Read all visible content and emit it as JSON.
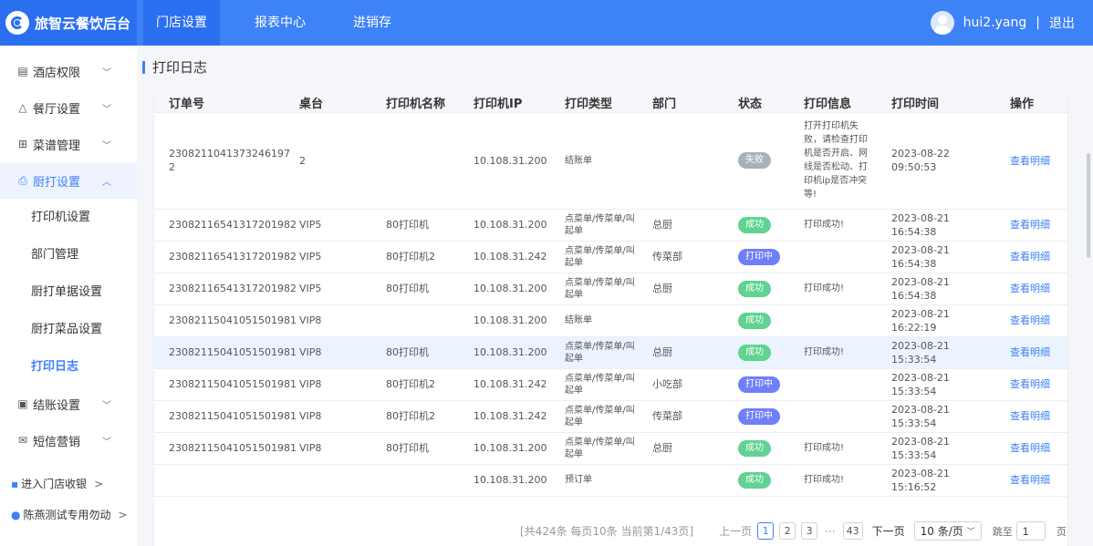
{
  "brand": {
    "name": "旅智云餐饮后台"
  },
  "topnav": [
    {
      "label": "门店设置"
    },
    {
      "label": "报表中心"
    },
    {
      "label": "进销存"
    }
  ],
  "user": {
    "name": "hui2.yang",
    "separator": "|",
    "logout": "退出"
  },
  "sidebar": {
    "groups": [
      {
        "label": "酒店权限",
        "icon": "hotel-icon"
      },
      {
        "label": "餐厅设置",
        "icon": "restaurant-icon"
      },
      {
        "label": "菜谱管理",
        "icon": "menu-grid-icon"
      },
      {
        "label": "厨打设置",
        "icon": "printer-icon"
      }
    ],
    "submenu": [
      {
        "label": "打印机设置"
      },
      {
        "label": "部门管理"
      },
      {
        "label": "厨打单据设置"
      },
      {
        "label": "厨打菜品设置"
      },
      {
        "label": "打印日志"
      }
    ],
    "groups2": [
      {
        "label": "结账设置",
        "icon": "checkout-icon"
      },
      {
        "label": "短信营销",
        "icon": "sms-icon"
      }
    ],
    "footer": {
      "shop_prefix": "进入门店收银",
      "shop_name": "陈燕测试专用勿动"
    }
  },
  "page": {
    "title": "打印日志"
  },
  "table": {
    "headers": [
      "订单号",
      "桌台",
      "打印机名称",
      "打印机IP",
      "打印类型",
      "部门",
      "状态",
      "打印信息",
      "打印时间",
      "操作"
    ],
    "rows": [
      {
        "order": "2308211041373246197​2",
        "table": "2",
        "printer": "",
        "ip": "10.108.31.200",
        "type": "结账单",
        "dept": "",
        "status": "失败",
        "status_kind": "fail",
        "info": "打开打印机失败，请检查打印机是否开启、网线是否松动、打印机ip是否冲突等!",
        "time": "2023-08-22 09:50:53",
        "action": "查看明细"
      },
      {
        "order": "23082116541317201982",
        "table": "VIP5",
        "printer": "80打印机",
        "ip": "10.108.31.200",
        "type": "点菜单/传菜单/叫起单",
        "dept": "总厨",
        "status": "成功",
        "status_kind": "ok",
        "info": "打印成功!",
        "time": "2023-08-21 16:54:38",
        "action": "查看明细"
      },
      {
        "order": "23082116541317201982",
        "table": "VIP5",
        "printer": "80打印机2",
        "ip": "10.108.31.242",
        "type": "点菜单/传菜单/叫起单",
        "dept": "传菜部",
        "status": "打印中",
        "status_kind": "printing",
        "info": "",
        "time": "2023-08-21 16:54:38",
        "action": "查看明细"
      },
      {
        "order": "23082116541317201982",
        "table": "VIP5",
        "printer": "80打印机",
        "ip": "10.108.31.200",
        "type": "点菜单/传菜单/叫起单",
        "dept": "总厨",
        "status": "成功",
        "status_kind": "ok",
        "info": "打印成功!",
        "time": "2023-08-21 16:54:38",
        "action": "查看明细"
      },
      {
        "order": "23082115041051501981",
        "table": "VIP8",
        "printer": "",
        "ip": "10.108.31.200",
        "type": "结账单",
        "dept": "",
        "status": "成功",
        "status_kind": "ok",
        "info": "",
        "time": "2023-08-21 16:22:19",
        "action": "查看明细"
      },
      {
        "order": "23082115041051501981",
        "table": "VIP8",
        "printer": "80打印机",
        "ip": "10.108.31.200",
        "type": "点菜单/传菜单/叫起单",
        "dept": "总厨",
        "status": "成功",
        "status_kind": "ok",
        "info": "打印成功!",
        "time": "2023-08-21 15:33:54",
        "action": "查看明细"
      },
      {
        "order": "23082115041051501981",
        "table": "VIP8",
        "printer": "80打印机2",
        "ip": "10.108.31.242",
        "type": "点菜单/传菜单/叫起单",
        "dept": "小吃部",
        "status": "打印中",
        "status_kind": "printing",
        "info": "",
        "time": "2023-08-21 15:33:54",
        "action": "查看明细"
      },
      {
        "order": "23082115041051501981",
        "table": "VIP8",
        "printer": "80打印机2",
        "ip": "10.108.31.242",
        "type": "点菜单/传菜单/叫起单",
        "dept": "传菜部",
        "status": "打印中",
        "status_kind": "printing",
        "info": "",
        "time": "2023-08-21 15:33:54",
        "action": "查看明细"
      },
      {
        "order": "23082115041051501981",
        "table": "VIP8",
        "printer": "80打印机",
        "ip": "10.108.31.200",
        "type": "点菜单/传菜单/叫起单",
        "dept": "总厨",
        "status": "成功",
        "status_kind": "ok",
        "info": "打印成功!",
        "time": "2023-08-21 15:33:54",
        "action": "查看明细"
      },
      {
        "order": "",
        "table": "",
        "printer": "",
        "ip": "10.108.31.200",
        "type": "预订单",
        "dept": "",
        "status": "成功",
        "status_kind": "ok",
        "info": "打印成功!",
        "time": "2023-08-21 15:16:52",
        "action": "查看明细"
      }
    ]
  },
  "pagination": {
    "summary": "[共424条 每页10条 当前第1/43页]",
    "prev": "上一页",
    "pages": [
      "1",
      "2",
      "3"
    ],
    "ellipsis": "···",
    "last": "43",
    "next": "下一页",
    "page_size": "10 条/页",
    "jump_label": "跳至",
    "jump_value": "1",
    "page_unit": "页"
  },
  "colors": {
    "primary": "#3e82f7",
    "success": "#5fd38f",
    "fail": "#aab1bb",
    "printing": "#6f7ff7"
  }
}
